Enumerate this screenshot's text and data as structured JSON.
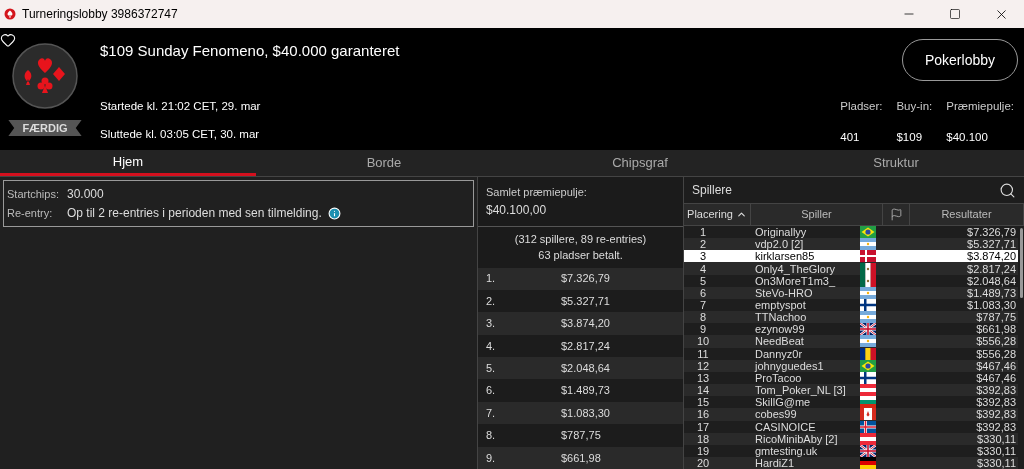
{
  "window": {
    "title": "Turneringslobby 3986372747"
  },
  "tournament": {
    "name": "$109 Sunday Fenomeno, $40.000 garanteret",
    "status": "FÆRDIG",
    "started": "Startede kl. 21:02 CET, 29. mar",
    "ended": "Sluttede kl. 03:05 CET, 30. mar"
  },
  "lobby_button": "Pokerlobby",
  "stats": [
    {
      "label": "Pladser:",
      "value": "401"
    },
    {
      "label": "Buy-in:",
      "value": "$109"
    },
    {
      "label": "Præmiepulje:",
      "value": "$40.100"
    }
  ],
  "tabs": [
    {
      "label": "Hjem",
      "selected": true
    },
    {
      "label": "Borde",
      "selected": false
    },
    {
      "label": "Chipsgraf",
      "selected": false
    },
    {
      "label": "Struktur",
      "selected": false
    }
  ],
  "info": [
    {
      "label": "Startchips:",
      "value": "30.000",
      "info": false
    },
    {
      "label": "Re-entry:",
      "value": "Op til 2 re-entries i perioden med sen tilmelding.",
      "info": true
    }
  ],
  "prize_pool": {
    "label": "Samlet præmiepulje:",
    "total": "$40.100,00",
    "entries": "(312 spillere, 89 re-entries)",
    "paid": "63 pladser betalt.",
    "payouts": [
      {
        "place": "1.",
        "amount": "$7.326,79"
      },
      {
        "place": "2.",
        "amount": "$5.327,71"
      },
      {
        "place": "3.",
        "amount": "$3.874,20"
      },
      {
        "place": "4.",
        "amount": "$2.817,24"
      },
      {
        "place": "5.",
        "amount": "$2.048,64"
      },
      {
        "place": "6.",
        "amount": "$1.489,73"
      },
      {
        "place": "7.",
        "amount": "$1.083,30"
      },
      {
        "place": "8.",
        "amount": "$787,75"
      },
      {
        "place": "9.",
        "amount": "$661,98"
      }
    ]
  },
  "players": {
    "title": "Spillere",
    "columns": [
      {
        "kind": "text",
        "label": "Placering",
        "sorted": true
      },
      {
        "kind": "text",
        "label": "Spiller",
        "sorted": false
      },
      {
        "kind": "flag",
        "sorted": false
      },
      {
        "kind": "text",
        "label": "Resultater",
        "sorted": false
      }
    ],
    "rows": [
      {
        "rank": "1",
        "name": "Originallyy",
        "kind": "br",
        "result": "$7.326,79",
        "selected": false
      },
      {
        "rank": "2",
        "name": "vdp2.0 [2]",
        "kind": "ar",
        "result": "$5.327,71",
        "selected": false
      },
      {
        "rank": "3",
        "name": "kirklarsen85",
        "kind": "dk",
        "result": "$3.874,20",
        "selected": true
      },
      {
        "rank": "4",
        "name": "Only4_TheGlory",
        "kind": "mx",
        "result": "$2.817,24",
        "selected": false
      },
      {
        "rank": "5",
        "name": "On3MoreT1m3_",
        "kind": "mx",
        "result": "$2.048,64",
        "selected": false
      },
      {
        "rank": "6",
        "name": "SteVo-HRO",
        "kind": "ar",
        "result": "$1.489,73",
        "selected": false
      },
      {
        "rank": "7",
        "name": "emptyspot",
        "kind": "fi",
        "result": "$1.083,30",
        "selected": false
      },
      {
        "rank": "8",
        "name": "TTNachoo",
        "kind": "ar",
        "result": "$787,75",
        "selected": false
      },
      {
        "rank": "9",
        "name": "ezynow99",
        "kind": "gb",
        "result": "$661,98",
        "selected": false
      },
      {
        "rank": "10",
        "name": "NeedBeat",
        "kind": "ar",
        "result": "$556,28",
        "selected": false
      },
      {
        "rank": "11",
        "name": "Dannyz0r",
        "kind": "ro",
        "result": "$556,28",
        "selected": false
      },
      {
        "rank": "12",
        "name": "johnyguedes1",
        "kind": "br",
        "result": "$467,46",
        "selected": false
      },
      {
        "rank": "13",
        "name": "ProTacoo",
        "kind": "fi",
        "result": "$467,46",
        "selected": false
      },
      {
        "rank": "14",
        "name": "Tom_Poker_NL [3]",
        "kind": "at",
        "result": "$392,83",
        "selected": false
      },
      {
        "rank": "15",
        "name": "SkillG@me",
        "kind": "bg",
        "result": "$392,83",
        "selected": false
      },
      {
        "rank": "16",
        "name": "cobes99",
        "kind": "ca",
        "result": "$392,83",
        "selected": false
      },
      {
        "rank": "17",
        "name": "CASINOICE",
        "kind": "is",
        "result": "$392,83",
        "selected": false
      },
      {
        "rank": "18",
        "name": "RicoMinibAby [2]",
        "kind": "at",
        "result": "$330,11",
        "selected": false
      },
      {
        "rank": "19",
        "name": "gmtesting.uk",
        "kind": "gb",
        "result": "$330,11",
        "selected": false
      },
      {
        "rank": "20",
        "name": "HardiZ1",
        "kind": "de",
        "result": "$330,11",
        "selected": false
      }
    ]
  }
}
